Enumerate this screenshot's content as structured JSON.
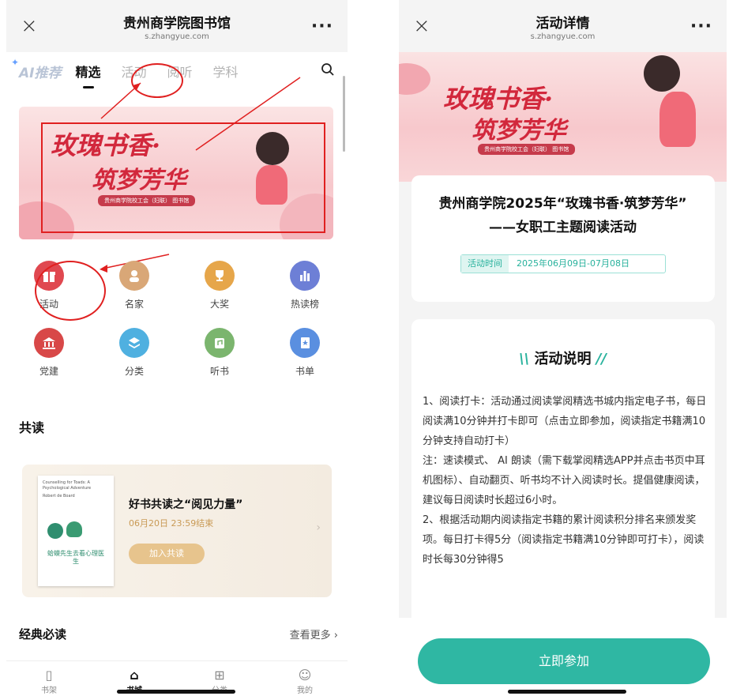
{
  "left": {
    "topbar": {
      "close": "×",
      "title": "贵州商学院图书馆",
      "url": "s.zhangyue.com",
      "more": "···"
    },
    "tabs": {
      "ai": "AI推荐",
      "items": [
        "精选",
        "活动",
        "阅听",
        "学科"
      ],
      "search_icon": "search-icon"
    },
    "banner": {
      "line1": "玫瑰书香·",
      "line2": "筑梦芳华",
      "sub": "贵州商学院校工会（妇联） 图书馆"
    },
    "grid": [
      {
        "label": "活动",
        "icon": "gift-icon",
        "glyph": "🎁",
        "color": "#e04850"
      },
      {
        "label": "名家",
        "icon": "person-icon",
        "glyph": "👤",
        "color": "#d9a777"
      },
      {
        "label": "大奖",
        "icon": "trophy-icon",
        "glyph": "🏆",
        "color": "#e6a64a"
      },
      {
        "label": "热读榜",
        "icon": "chart-icon",
        "glyph": "▮",
        "color": "#6d7fd6"
      },
      {
        "label": "党建",
        "icon": "building-icon",
        "glyph": "🏛",
        "color": "#d84848"
      },
      {
        "label": "分类",
        "icon": "layers-icon",
        "glyph": "◈",
        "color": "#4fb0e0"
      },
      {
        "label": "听书",
        "icon": "headphone-icon",
        "glyph": "♫",
        "color": "#7bb56e"
      },
      {
        "label": "书单",
        "icon": "book-icon",
        "glyph": "★",
        "color": "#5a8fe0"
      }
    ],
    "coread_title": "共读",
    "coread": {
      "book_title_en": "Counselling for Toads: A Psychological Adventure",
      "book_author": "Robert de Board",
      "book_title_cn": "蛤蟆先生去看心理医生",
      "title": "好书共读之“阅见力量”",
      "time": "06月20日 23:59结束",
      "join": "加入共读",
      "arrow": "›"
    },
    "classic": {
      "title": "经典必读",
      "more": "查看更多 ›"
    },
    "nav": [
      {
        "label": "书架",
        "glyph": "▯",
        "icon": "shelf-icon"
      },
      {
        "label": "书城",
        "glyph": "⌂",
        "icon": "home-icon"
      },
      {
        "label": "分类",
        "glyph": "⊞",
        "icon": "grid-icon"
      },
      {
        "label": "我的",
        "glyph": "☺",
        "icon": "profile-icon"
      }
    ]
  },
  "right": {
    "topbar": {
      "close": "×",
      "title": "活动详情",
      "url": "s.zhangyue.com",
      "more": "···"
    },
    "banner": {
      "line1": "玫瑰书香·",
      "line2": "筑梦芳华",
      "sub": "贵州商学院校工会（妇联） 图书馆"
    },
    "headline_1": "贵州商学院2025年“玫瑰书香·筑梦芳华”",
    "headline_2": "——女职工主题阅读活动",
    "time_label": "活动时间",
    "time_value": "2025年06月09日-07月08日",
    "section_title": "活动说明",
    "description": "1、阅读打卡：活动通过阅读掌阅精选书城内指定电子书，每日阅读满10分钟并打卡即可（点击立即参加，阅读指定书籍满10分钟支持自动打卡）\n注：速读模式、 AI 朗读（需下载掌阅精选APP并点击书页中耳机图标）、自动翻页、听书均不计入阅读时长。提倡健康阅读，建议每日阅读时长超过6小时。\n2、根据活动期内阅读指定书籍的累计阅读积分排名来颁发奖项。每日打卡得5分（阅读指定书籍满10分钟即可打卡），阅读时长每30分钟得5",
    "cta": "立即参加"
  },
  "colors": {
    "accent_teal": "#2fb7a3",
    "annotation_red": "#e02020",
    "banner_red": "#d2283c"
  }
}
